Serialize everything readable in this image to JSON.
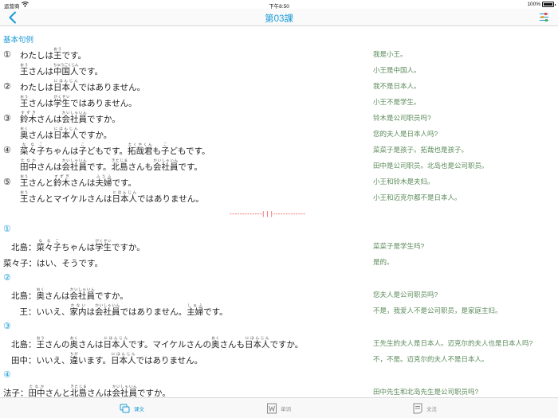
{
  "status_bar": {
    "carrier": "运营商",
    "time": "下午8:50",
    "battery": "100%",
    "battery_level": 1.0
  },
  "nav": {
    "title": "第03課",
    "back_icon": "chevron-left-icon",
    "settings_icon": "sliders-icon"
  },
  "section": {
    "title": "基本句例"
  },
  "sentences": [
    {
      "num": "①",
      "jp": [
        {
          "t": "わたしは"
        },
        {
          "t": "王",
          "r": "おう"
        },
        {
          "t": "です。"
        }
      ],
      "cn": "我是小王。"
    },
    {
      "num": "",
      "jp": [
        {
          "t": "王",
          "r": "おう"
        },
        {
          "t": "さんは"
        },
        {
          "t": "中国人",
          "r": "ちゅうごくじん"
        },
        {
          "t": "です。"
        }
      ],
      "cn": "小王是中国人。"
    },
    {
      "num": "②",
      "jp": [
        {
          "t": "わたしは"
        },
        {
          "t": "日本人",
          "r": "にほんじん"
        },
        {
          "t": "ではありません。"
        }
      ],
      "cn": "我不是日本人。"
    },
    {
      "num": "",
      "jp": [
        {
          "t": "王",
          "r": "おう"
        },
        {
          "t": "さんは"
        },
        {
          "t": "学生",
          "r": "がくせい"
        },
        {
          "t": "ではありません。"
        }
      ],
      "cn": "小王不是学生。"
    },
    {
      "num": "③",
      "jp": [
        {
          "t": "鈴木",
          "r": "すずき"
        },
        {
          "t": "さんは"
        },
        {
          "t": "会社員",
          "r": "かいしゃいん"
        },
        {
          "t": "ですか。"
        }
      ],
      "cn": "铃木是公司职员吗?"
    },
    {
      "num": "",
      "jp": [
        {
          "t": "奥",
          "r": "おく"
        },
        {
          "t": "さんは"
        },
        {
          "t": "日本人",
          "r": "にほんじん"
        },
        {
          "t": "ですか。"
        }
      ],
      "cn": "您的夫人是日本人吗?"
    },
    {
      "num": "④",
      "jp": [
        {
          "t": "菜々子",
          "r": "ななこ"
        },
        {
          "t": "ちゃんは"
        },
        {
          "t": "子",
          "r": "こ"
        },
        {
          "t": "どもです。"
        },
        {
          "t": "拓哉君",
          "r": "たくやくん"
        },
        {
          "t": "も"
        },
        {
          "t": "子",
          "r": "こ"
        },
        {
          "t": "どもです。"
        }
      ],
      "cn": "菜菜子是孩子。拓哉也是孩子。"
    },
    {
      "num": "",
      "jp": [
        {
          "t": "田中",
          "r": "たなか"
        },
        {
          "t": "さんは"
        },
        {
          "t": "会社員",
          "r": "かいしゃいん"
        },
        {
          "t": "です。"
        },
        {
          "t": "北島",
          "r": "きたじま"
        },
        {
          "t": "さんも"
        },
        {
          "t": "会社員",
          "r": "かいしゃいん"
        },
        {
          "t": "です。"
        }
      ],
      "cn": "田中是公司职员。北岛也是公司职员。"
    },
    {
      "num": "⑤",
      "jp": [
        {
          "t": "王",
          "r": "おう"
        },
        {
          "t": "さんと"
        },
        {
          "t": "鈴木",
          "r": "すずき"
        },
        {
          "t": "さんは"
        },
        {
          "t": "夫婦",
          "r": "ふうふ"
        },
        {
          "t": "です。"
        }
      ],
      "cn": "小王和铃木是夫妇。"
    },
    {
      "num": "",
      "jp": [
        {
          "t": "王",
          "r": "おう"
        },
        {
          "t": "さんとマイケルさんは"
        },
        {
          "t": "日本人",
          "r": "にほんじん"
        },
        {
          "t": "ではありません。"
        }
      ],
      "cn": "小王和迈克尔都不是日本人。"
    }
  ],
  "divider": "-------------| | |-------------",
  "dialogues": [
    {
      "num": "①",
      "lines": [
        {
          "indent": true,
          "jp": [
            {
              "t": "北島"
            },
            {
              "t": "："
            },
            {
              "t": "菜々子",
              "r": "ななこ"
            },
            {
              "t": "ちゃんは"
            },
            {
              "t": "学生",
              "r": "がくせい"
            },
            {
              "t": "ですか。"
            }
          ],
          "cn": "菜菜子是学生吗?"
        },
        {
          "indent": false,
          "jp": [
            {
              "t": "菜々子"
            },
            {
              "t": "：はい、そうです。"
            }
          ],
          "cn": "是的。"
        }
      ]
    },
    {
      "num": "②",
      "lines": [
        {
          "indent": true,
          "jp": [
            {
              "t": "北島"
            },
            {
              "t": "："
            },
            {
              "t": "奥",
              "r": "おく"
            },
            {
              "t": "さんは"
            },
            {
              "t": "会社員",
              "r": "かいしゃいん"
            },
            {
              "t": "ですか。"
            }
          ],
          "cn": "您夫人是公司职员吗?"
        },
        {
          "indent": true,
          "jp": [
            {
              "t": "　王"
            },
            {
              "t": "：いいえ、"
            },
            {
              "t": "家内",
              "r": "かない"
            },
            {
              "t": "は"
            },
            {
              "t": "会社員",
              "r": "かいしゃいん"
            },
            {
              "t": "ではありません。"
            },
            {
              "t": "主婦",
              "r": "しゅふ"
            },
            {
              "t": "です。"
            }
          ],
          "cn": "不是，我爱人不是公司职员，是家庭主妇。"
        }
      ]
    },
    {
      "num": "③",
      "lines": [
        {
          "indent": true,
          "jp": [
            {
              "t": "北島"
            },
            {
              "t": "："
            },
            {
              "t": "王",
              "r": "おう"
            },
            {
              "t": "さんの"
            },
            {
              "t": "奥",
              "r": "おく"
            },
            {
              "t": "さんは"
            },
            {
              "t": "日本人",
              "r": "にほんじん"
            },
            {
              "t": "です。マイケルさんの"
            },
            {
              "t": "奥",
              "r": "おく"
            },
            {
              "t": "さんも"
            },
            {
              "t": "日本人",
              "r": "にほんじん"
            },
            {
              "t": "ですか。"
            }
          ],
          "cn": "王先生的夫人是日本人。迈克尔的夫人也是日本人吗?"
        },
        {
          "indent": true,
          "jp": [
            {
              "t": "田中"
            },
            {
              "t": "：いいえ、"
            },
            {
              "t": "違",
              "r": "ちが"
            },
            {
              "t": "います。"
            },
            {
              "t": "日本人",
              "r": "にほんじん"
            },
            {
              "t": "ではありません。"
            }
          ],
          "cn": "不，不是。迈克尔的夫人不是日本人。"
        }
      ]
    },
    {
      "num": "④",
      "lines": [
        {
          "indent": false,
          "jp": [
            {
              "t": "法子"
            },
            {
              "t": "："
            },
            {
              "t": "田中",
              "r": "たなか"
            },
            {
              "t": "さんと"
            },
            {
              "t": "北島",
              "r": "きたじま"
            },
            {
              "t": "さんは"
            },
            {
              "t": "会社員",
              "r": "かいしゃいん"
            },
            {
              "t": "ですか。"
            }
          ],
          "cn": "田中先生和北岛先生是公司职员吗?"
        }
      ]
    }
  ],
  "tabs": [
    {
      "label": "课文",
      "icon": "text-lesson-icon",
      "active": true
    },
    {
      "label": "单词",
      "icon": "word-icon",
      "active": false
    },
    {
      "label": "文法",
      "icon": "grammar-icon",
      "active": false
    }
  ]
}
